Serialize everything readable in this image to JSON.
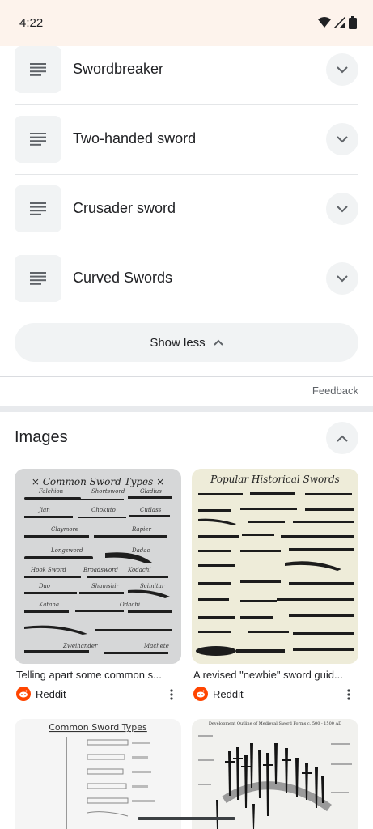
{
  "status_bar": {
    "time": "4:22"
  },
  "rows": [
    {
      "label": "Swordbreaker"
    },
    {
      "label": "Two-handed sword"
    },
    {
      "label": "Crusader sword"
    },
    {
      "label": "Curved Swords"
    }
  ],
  "show_less": {
    "label": "Show less"
  },
  "feedback": {
    "label": "Feedback"
  },
  "images": {
    "title": "Images",
    "results": [
      {
        "caption": "Telling apart some common s...",
        "source": "Reddit",
        "poster_title": "× Common Sword Types ×"
      },
      {
        "caption": "A revised \"newbie\" sword guid...",
        "source": "Reddit",
        "poster_title": "Popular Historical Swords"
      },
      {
        "poster_title": "Common Sword Types"
      },
      {
        "poster_title": "Development Outline of Medieval Sword Forms c. 500 - 1500 AD"
      }
    ]
  },
  "colors": {
    "status_bg": "#fdf3ec",
    "chip_bg": "#f1f3f4",
    "reddit": "#ff4500"
  }
}
